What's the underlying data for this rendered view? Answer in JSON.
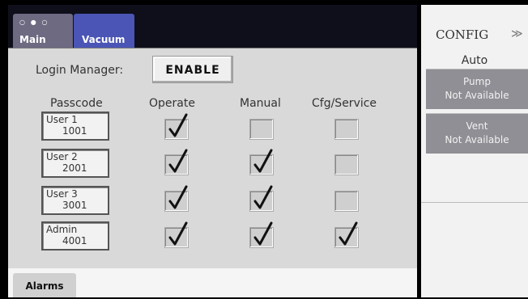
{
  "tabs": {
    "main_dots": "○ ● ○",
    "main_label": "Main",
    "vacuum_label": "Vacuum"
  },
  "login": {
    "label": "Login Manager:",
    "button": "ENABLE"
  },
  "columns": {
    "passcode": "Passcode",
    "operate": "Operate",
    "manual": "Manual",
    "cfg": "Cfg/Service"
  },
  "users": [
    {
      "name": "User 1",
      "code": "1001",
      "operate": true,
      "manual": false,
      "cfg": false
    },
    {
      "name": "User 2",
      "code": "2001",
      "operate": true,
      "manual": true,
      "cfg": false
    },
    {
      "name": "User 3",
      "code": "3001",
      "operate": true,
      "manual": true,
      "cfg": false
    },
    {
      "name": "Admin",
      "code": "4001",
      "operate": true,
      "manual": true,
      "cfg": true
    }
  ],
  "bottom": {
    "alarms": "Alarms"
  },
  "right": {
    "config": "CONFIG",
    "chevron": "≫",
    "auto": "Auto",
    "pump_line1": "Pump",
    "pump_line2": "Not Available",
    "vent_line1": "Vent",
    "vent_line2": "Not Available"
  },
  "colors": {
    "active_tab": "#4a55b6",
    "panel": "#d9d9d9",
    "side_button": "#8f8f95"
  }
}
